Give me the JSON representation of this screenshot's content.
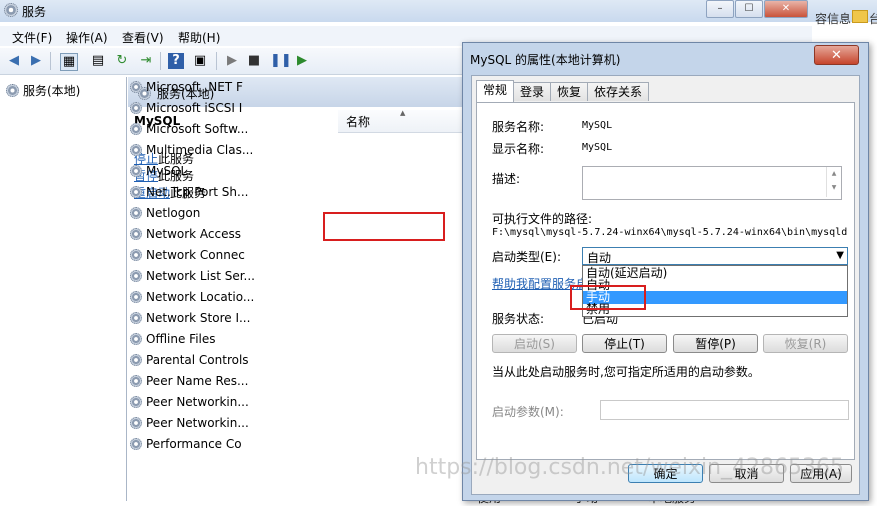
{
  "window": {
    "title": "服务",
    "min": "–",
    "max": "☐",
    "close": "✕",
    "behind_text": "容信息",
    "behind_text2": "台"
  },
  "menu": [
    "文件(F)",
    "操作(A)",
    "查看(V)",
    "帮助(H)"
  ],
  "toolbar_icons": [
    "back-icon",
    "forward-icon",
    "console-tree-icon",
    "properties-icon",
    "refresh-icon",
    "export-icon",
    "help-icon",
    "action-pane-icon",
    "start-icon",
    "stop-icon",
    "pause-icon",
    "resume-icon"
  ],
  "tree": {
    "root": "服务(本地)"
  },
  "content": {
    "header": "服务(本地)",
    "selected_service": "MySQL",
    "actions": [
      {
        "link": "停止",
        "rest": "此服务"
      },
      {
        "link": "暂停",
        "rest": "此服务"
      },
      {
        "link": "重启动",
        "rest": "此服务"
      }
    ],
    "column_name": "名称",
    "services": [
      "Microsoft .NET F",
      "Microsoft iSCSI I",
      "Microsoft Softw...",
      "Multimedia Clas...",
      "MySQL",
      "Net.Tcp Port Sh...",
      "Netlogon",
      "Network Access",
      "Network Connec",
      "Network List Ser...",
      "Network Locatio...",
      "Network Store I...",
      "Offline Files",
      "Parental Controls",
      "Peer Name Res...",
      "Peer Networkin...",
      "Peer Networkin...",
      "Performance Co"
    ],
    "last_row_cols": [
      "使用",
      "手动",
      "本地服务"
    ]
  },
  "dialog": {
    "title": "MySQL 的属性(本地计算机)",
    "close": "✕",
    "tabs": [
      "常规",
      "登录",
      "恢复",
      "依存关系"
    ],
    "service_name_label": "服务名称:",
    "service_name": "MySQL",
    "display_name_label": "显示名称:",
    "display_name": "MySQL",
    "description_label": "描述:",
    "exe_path_label": "可执行文件的路径:",
    "exe_path": "F:\\mysql\\mysql-5.7.24-winx64\\mysql-5.7.24-winx64\\bin\\mysqld",
    "startup_type_label": "启动类型(E):",
    "startup_type_value": "自动",
    "startup_options": [
      "自动(延迟启动)",
      "自动",
      "手动",
      "禁用"
    ],
    "help_link": "帮助我配置服务启",
    "status_label": "服务状态:",
    "status_value": "已启动",
    "buttons": {
      "start": "启动(S)",
      "stop": "停止(T)",
      "pause": "暂停(P)",
      "resume": "恢复(R)"
    },
    "hint": "当从此处启动服务时,您可指定所适用的启动参数。",
    "params_label": "启动参数(M):",
    "footer": {
      "ok": "确定",
      "cancel": "取消",
      "apply": "应用(A)"
    }
  },
  "watermark": "https://blog.csdn.net/weixin_42865365"
}
